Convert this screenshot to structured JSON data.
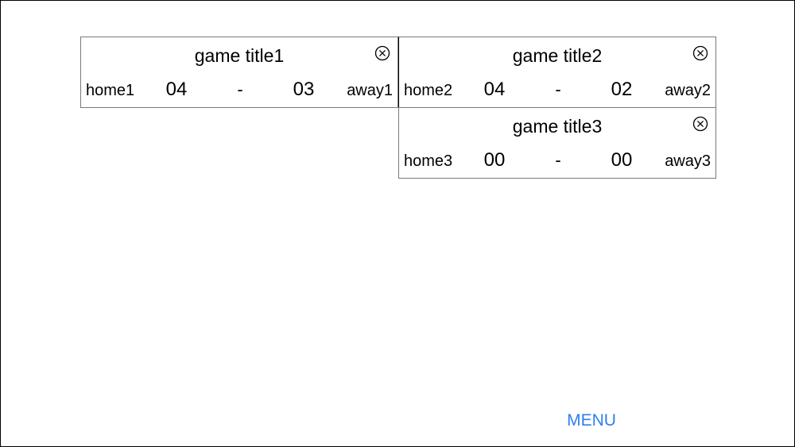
{
  "games": [
    {
      "title": "game title1",
      "home_team": "home1",
      "home_score": "04",
      "separator": "-",
      "away_score": "03",
      "away_team": "away1"
    },
    {
      "title": "game title2",
      "home_team": "home2",
      "home_score": "04",
      "separator": "-",
      "away_score": "02",
      "away_team": "away2"
    },
    {
      "title": "game title3",
      "home_team": "home3",
      "home_score": "00",
      "separator": "-",
      "away_score": "00",
      "away_team": "away3"
    }
  ],
  "icons": {
    "close": "close-circle-x-icon"
  },
  "menu": {
    "label": "MENU",
    "color": "#2f80ed"
  }
}
